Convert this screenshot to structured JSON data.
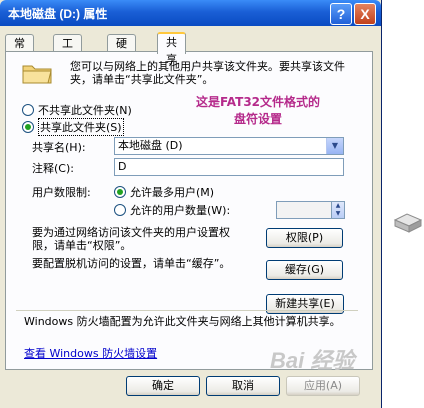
{
  "window": {
    "title": "本地磁盘 (D:) 属性",
    "help_label": "?",
    "close_label": "X"
  },
  "tabs": [
    {
      "label": "常规"
    },
    {
      "label": "工具"
    },
    {
      "label": "硬件"
    },
    {
      "label": "共享"
    }
  ],
  "active_tab": "共享",
  "intro_text": "您可以与网络上的其他用户共享该文件夹。要共享该文件夹，请单击“共享此文件夹”。",
  "annotation": {
    "line1": "这是FAT32文件格式的",
    "line2": "盘符设置"
  },
  "sharing": {
    "no_share_label": "不共享此文件夹(N)",
    "share_label": "共享此文件夹(S)",
    "share_name_label": "共享名(H):",
    "share_name_value": "本地磁盘 (D)",
    "comment_label": "注释(C):",
    "comment_value": "D",
    "user_limit_label": "用户数限制:",
    "max_allowed_label": "允许最多用户(M)",
    "allow_users_label": "允许的用户数量(W):",
    "permissions_text": "要为通过网络访问该文件夹的用户设置权限，请单击“权限”。",
    "permissions_button": "权限(P)",
    "caching_text": "要配置脱机访问的设置，请单击“缓存”。",
    "caching_button": "缓存(G)",
    "new_share_button": "新建共享(E)"
  },
  "firewall": {
    "text": "Windows 防火墙配置为允许此文件夹与网络上其他计算机共享。",
    "link": "查看 Windows 防火墙设置"
  },
  "footer": {
    "ok": "确定",
    "cancel": "取消",
    "apply": "应用(A)"
  },
  "watermark": "Bai 经验"
}
